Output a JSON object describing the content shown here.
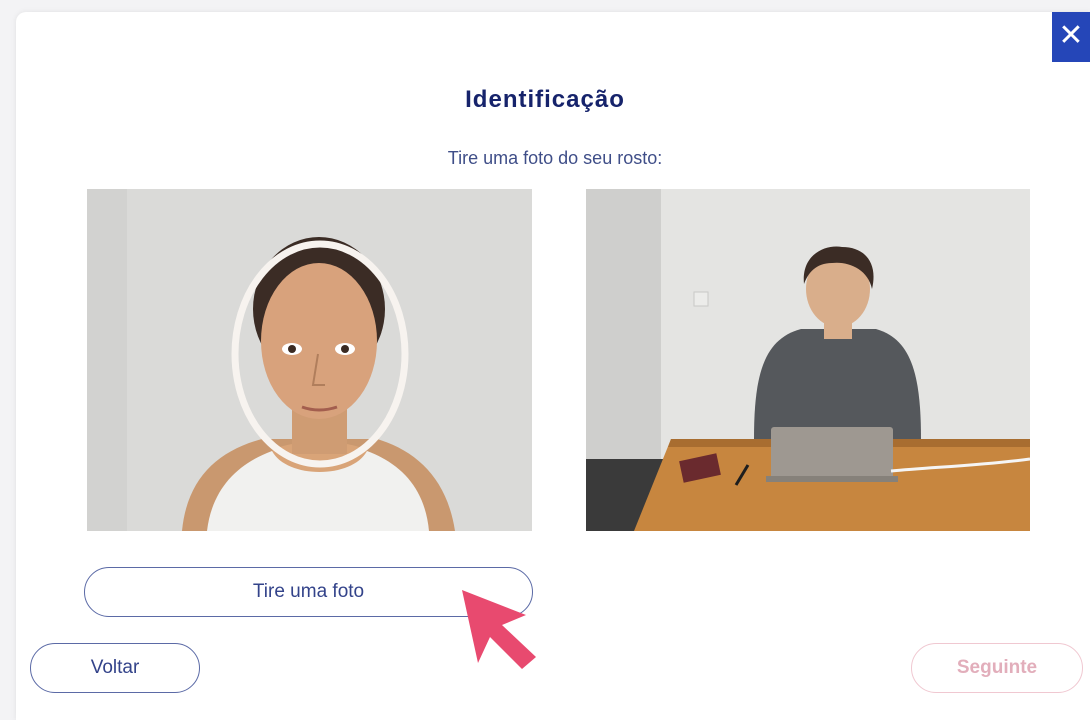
{
  "dialog": {
    "close_label": "✕",
    "title": "Identificação",
    "subtitle": "Tire uma foto do seu rosto:"
  },
  "camera": {
    "left_image": "selfie-face-frame",
    "right_image": "person-at-laptop"
  },
  "buttons": {
    "take_photo": "Tire uma foto",
    "back": "Voltar",
    "next": "Seguinte"
  },
  "colors": {
    "title": "#16236b",
    "accent": "#2546b8",
    "disabled_pink": "#e2aebb",
    "cursor": "#e84a6f"
  }
}
